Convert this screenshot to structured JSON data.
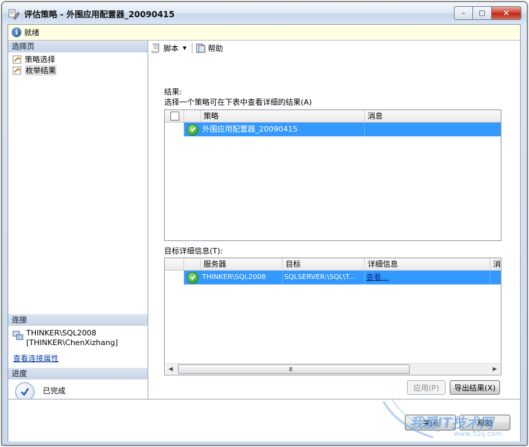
{
  "window": {
    "title": "评估策略 - 外围应用配置器_20090415",
    "buttons": {
      "minimize": "–",
      "maximize": "□",
      "close": "✕"
    }
  },
  "status": {
    "text": "就绪"
  },
  "left": {
    "select_page_header": "选择页",
    "nav": [
      {
        "label": "策略选择"
      },
      {
        "label": "枚举结果"
      }
    ],
    "connection_header": "连接",
    "connection_server": "THINKER\\SQL2008",
    "connection_user": "[THINKER\\ChenXizhang]",
    "connection_link": "查看连接属性",
    "progress_header": "进度",
    "progress_status": "已完成"
  },
  "toolbar": {
    "script_label": "脚本",
    "help_label": "帮助"
  },
  "results": {
    "label": "结果:",
    "instruction": "选择一个策略可在下表中查看详细的结果(A)",
    "columns": [
      "策略",
      "消息"
    ],
    "rows": [
      {
        "policy": "外围应用配置器_20090415",
        "message": ""
      }
    ]
  },
  "target_details": {
    "label": "目标详细信息(T):",
    "columns": [
      "服务器",
      "目标",
      "详细信息",
      "消"
    ],
    "rows": [
      {
        "server": "THINKER\\SQL2008",
        "target": "SQLSERVER:\\SQL\\T...",
        "details": "查看..."
      }
    ]
  },
  "actions": {
    "apply": "应用(P)",
    "export": "导出结果(X)"
  },
  "footer": {
    "close": "关闭",
    "help": "帮助"
  },
  "watermark": {
    "text": "我爱IT技术网",
    "url": "www.52ij.com"
  }
}
